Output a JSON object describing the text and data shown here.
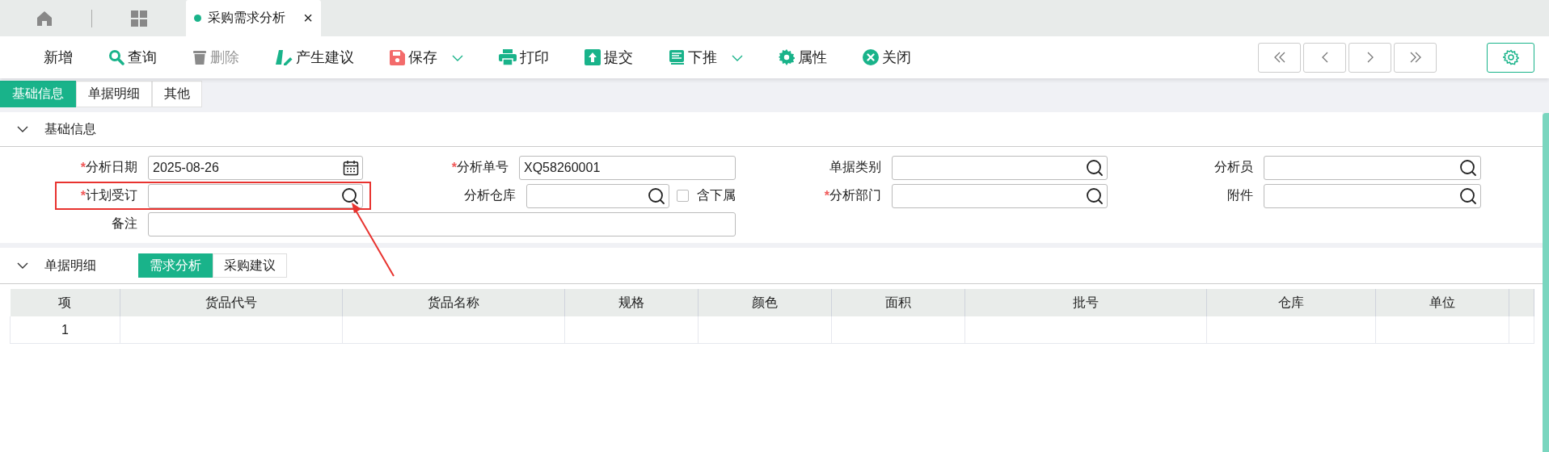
{
  "tabs": [
    {
      "kind": "home",
      "selected": false
    },
    {
      "kind": "apps",
      "selected": false
    },
    {
      "kind": "document",
      "label": "采购需求分析",
      "close": "×",
      "selected": true
    }
  ],
  "toolbar": [
    {
      "kind": "add",
      "label": "新增",
      "disabled": false,
      "dropdown": false
    },
    {
      "kind": "search",
      "label": "查询",
      "disabled": false,
      "dropdown": false
    },
    {
      "kind": "delete",
      "label": "删除",
      "disabled": true,
      "dropdown": false
    },
    {
      "kind": "suggest",
      "label": "产生建议",
      "disabled": false,
      "dropdown": false
    },
    {
      "kind": "save",
      "label": "保存",
      "disabled": false,
      "dropdown": true
    },
    {
      "kind": "print",
      "label": "打印",
      "disabled": false,
      "dropdown": false
    },
    {
      "kind": "submit",
      "label": "提交",
      "disabled": false,
      "dropdown": false
    },
    {
      "kind": "push",
      "label": "下推",
      "disabled": false,
      "dropdown": true
    },
    {
      "kind": "properties",
      "label": "属性",
      "disabled": false,
      "dropdown": false
    },
    {
      "kind": "close",
      "label": "关闭",
      "disabled": false,
      "dropdown": false
    }
  ],
  "form_tabs": [
    {
      "label": "基础信息",
      "selected": true
    },
    {
      "label": "单据明细",
      "selected": false
    },
    {
      "label": "其他",
      "selected": false
    }
  ],
  "basic": {
    "title": "基础信息",
    "expanded": true,
    "rows": [
      [
        {
          "required_mark": "*",
          "label": "分析日期",
          "kind": "date",
          "value": "2025-08-26",
          "highlighted": false
        },
        {
          "required_mark": "*",
          "label": "分析单号",
          "kind": "text",
          "value": "XQ58260001",
          "highlighted": false
        },
        {
          "label": "单据类别",
          "kind": "lookup",
          "highlighted": false
        },
        {
          "label": "分析员",
          "kind": "lookup",
          "highlighted": false
        }
      ],
      [
        {
          "required_mark": "*",
          "label": "计划受订",
          "kind": "lookup",
          "highlighted": true
        },
        {
          "label": "分析仓库",
          "kind": "lookup",
          "highlighted": false,
          "checkbox": {
            "label": "含下属",
            "checked": false
          }
        },
        {
          "required_mark": "*",
          "label": "分析部门",
          "kind": "lookup",
          "highlighted": false
        },
        {
          "label": "附件",
          "kind": "lookup",
          "highlighted": false
        }
      ],
      [
        {
          "label": "备注",
          "kind": "text",
          "highlighted": false
        }
      ]
    ]
  },
  "detail": {
    "title": "单据明细",
    "expanded": true,
    "tabs": [
      {
        "label": "需求分析",
        "selected": true
      },
      {
        "label": "采购建议",
        "selected": false
      }
    ],
    "table": {
      "columns": [
        "项",
        "货品代号",
        "货品名称",
        "规格",
        "颜色",
        "面积",
        "批号",
        "仓库",
        "单位"
      ],
      "rows": [
        {
          "index": "1"
        }
      ]
    }
  }
}
